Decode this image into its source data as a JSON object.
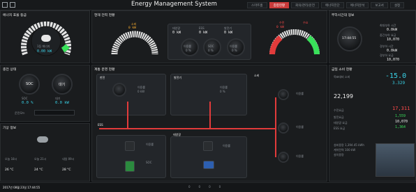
{
  "header": {
    "title": "Energy Management System",
    "tabs": [
      "스마트홈",
      "종합현황",
      "회의/관리/운전",
      "에너지진단",
      "에너지분석",
      "보고서",
      "설정"
    ],
    "active_tab": "종합현황"
  },
  "efficiency": {
    "title": "에너지 효율 등급",
    "grade_label": "1등 에너지",
    "grade_value": "0.00 kW"
  },
  "power": {
    "title": "현재 전력 현황",
    "consume_label": "소비",
    "consume_value": "0 kW",
    "charge_label": "충전",
    "charge_value": "0 kW",
    "supply_label": "수전",
    "supply_value": "0 kW",
    "rate_label": "이용률",
    "rate_value": "0 %",
    "soc_label": "SOC",
    "soc_value": "0 %",
    "solar_label": "태양광",
    "solar_value": "0 kW",
    "ess_label": "ESS",
    "ess_value": "0 kW",
    "gen_label": "발전기",
    "gen_value": "0 kW",
    "buy_label": "수전",
    "sell_label": "수요"
  },
  "clock": {
    "title": "부하시간대 정보",
    "time": "17:44:55",
    "items": [
      {
        "label": "최대부하 시간",
        "value": "0.0kW"
      },
      {
        "label": "중간부하 요금",
        "value": "10,070"
      },
      {
        "label": "경부하 시간",
        "value": "0.0kW"
      },
      {
        "label": "경부하 요금",
        "value": "10,070"
      }
    ]
  },
  "charge": {
    "title": "충전 상태",
    "soc": "SOC",
    "wait": "대기",
    "soc_value": "0.0 %",
    "wait_value": "0.0 kW",
    "mode_label": "운전모드"
  },
  "weather": {
    "title": "기상 정보",
    "days": [
      "오늘 18시",
      "오늘 21시",
      "내일 09시"
    ],
    "temps": [
      "26 °C",
      "24 °C",
      "28 °C"
    ]
  },
  "operation": {
    "title": "계통 운영 현황",
    "grid": "한전",
    "gen": "발전기",
    "load": "소비",
    "ess": "ESS",
    "solar": "태양광",
    "rate": "이용률",
    "unit": "0 %",
    "kw": "0 kW"
  },
  "usage": {
    "title": "금일 소비 현황",
    "main_value": "-15.0",
    "sub_value": "3.329",
    "left_label": "목표대비 소비",
    "big_number": "22,199",
    "rows": [
      {
        "label": "수전요금",
        "value": "17,311"
      },
      {
        "label": "발전요금",
        "value": "1,559"
      },
      {
        "label": "태양광 요금",
        "value": "10,070"
      },
      {
        "label": "ESS 요금",
        "value": "1,364"
      }
    ]
  },
  "building": {
    "info": [
      "설비용량 1,394.45 kWh",
      "계약전력 100 kW",
      "설치용량"
    ]
  },
  "footer": {
    "datetime": "2017년 08월 23일 17:44:55",
    "counts": [
      "0",
      "0",
      "0",
      "0"
    ]
  },
  "colors": {
    "accent": "#c93a3a",
    "cyan": "#39d3e8",
    "red": "#ff4a4a",
    "green": "#39e05a"
  }
}
